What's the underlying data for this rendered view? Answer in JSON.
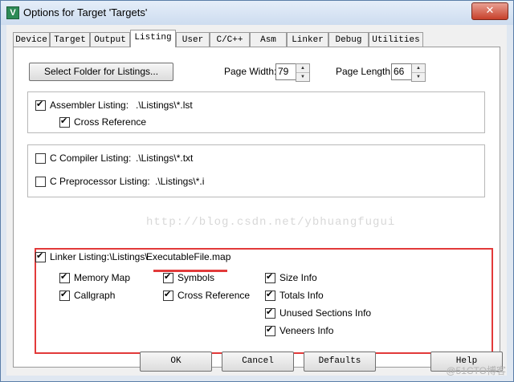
{
  "window": {
    "title": "Options for Target 'Targets'",
    "app_icon_letter": "V",
    "close_glyph": "✕"
  },
  "tabs": [
    "Device",
    "Target",
    "Output",
    "Listing",
    "User",
    "C/C++",
    "Asm",
    "Linker",
    "Debug",
    "Utilities"
  ],
  "active_tab": "Listing",
  "listing": {
    "select_folder_label": "Select Folder for Listings...",
    "page_width_label": "Page Width:",
    "page_width_value": "79",
    "page_length_label": "Page Length:",
    "page_length_value": "66",
    "assembler": {
      "label": "Assembler Listing:",
      "path": ".\\Listings\\*.lst",
      "checked": true,
      "cross_reference_label": "Cross Reference",
      "cross_reference_checked": true
    },
    "c_compiler": {
      "label": "C Compiler Listing:",
      "path": ".\\Listings\\*.txt",
      "checked": false
    },
    "c_preprocessor": {
      "label": "C Preprocessor Listing:",
      "path": ".\\Listings\\*.i",
      "checked": false
    },
    "linker": {
      "label": "Linker Listing:",
      "path_prefix": ".\\Listings\\",
      "path_file": "ExecutableFile.map",
      "checked": true,
      "options": {
        "memory_map": "Memory Map",
        "callgraph": "Callgraph",
        "symbols": "Symbols",
        "cross_reference": "Cross Reference",
        "size_info": "Size Info",
        "totals_info": "Totals Info",
        "unused_sections_info": "Unused Sections Info",
        "veneers_info": "Veneers Info"
      }
    }
  },
  "watermark": "http://blog.csdn.net/ybhuangfugui",
  "buttons": {
    "ok": "OK",
    "cancel": "Cancel",
    "defaults": "Defaults",
    "help": "Help"
  },
  "corner_watermark": "@51CTO博客",
  "colors": {
    "highlight": "#e23a3a",
    "frame": "#5b7ea8"
  }
}
